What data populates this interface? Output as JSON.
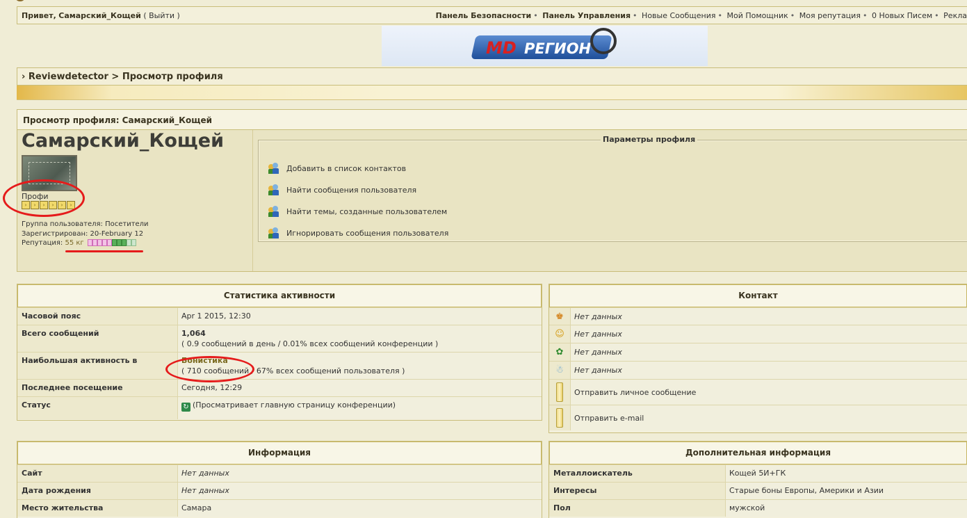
{
  "userbar": {
    "greeting": "Привет,",
    "username": "Самарский_Кощей",
    "logout": "( Выйти )",
    "links_bold": [
      "Панель Безопасности",
      "Панель Управления"
    ],
    "links": [
      "Новые Сообщения",
      "Мой Помощник",
      "Моя репутация",
      "0 Новых Писем",
      "Рекла"
    ]
  },
  "banner": {
    "md": "MD",
    "region": "РЕГИОН"
  },
  "nav": {
    "breadcrumb": "› Reviewdetector > Просмотр профиля"
  },
  "profile": {
    "header": "Просмотр профиля: Самарский_Кощей",
    "name": "Самарский_Кощей",
    "rank": "Профи",
    "pip_count": 6,
    "group": "Группа пользователя: Посетители",
    "registered": "Зарегистрирован: 20-February 12",
    "rep_label": "Репутация:",
    "rep_value": "55 кг",
    "params_title": "Параметры профиля",
    "params": [
      "Добавить в список контактов",
      "Найти сообщения пользователя",
      "Найти темы, созданные пользователем",
      "Игнорировать сообщения пользователя"
    ]
  },
  "stats": {
    "title": "Статистика активности",
    "timezone_label": "Часовой пояс",
    "timezone_value": "Apr 1 2015, 12:30",
    "posts_label": "Всего сообщений",
    "posts_value": "1,064",
    "posts_sub": "( 0.9 сообщений в день / 0.01% всех сообщений конференции )",
    "active_label": "Наибольшая активность в",
    "active_forum": "Бонистика",
    "active_sub": "( 710 сообщений / 67% всех сообщений пользователя )",
    "last_label": "Последнее посещение",
    "last_value": "Сегодня, 12:29",
    "status_label": "Статус",
    "status_value": "(Просматривает главную страницу конференции)"
  },
  "contact": {
    "title": "Контакт",
    "no_data": [
      "Нет данных",
      "Нет данных",
      "Нет данных",
      "Нет данных"
    ],
    "pm": "Отправить личное сообщение",
    "email": "Отправить e-mail"
  },
  "info": {
    "title": "Информация",
    "rows": [
      {
        "label": "Сайт",
        "value": "Нет данных"
      },
      {
        "label": "Дата рождения",
        "value": "Нет данных"
      },
      {
        "label": "Место жительства",
        "value": "Самара"
      }
    ]
  },
  "extra": {
    "title": "Дополнительная информация",
    "rows": [
      {
        "label": "Металлоискатель",
        "value": "Кощей 5И+ГК"
      },
      {
        "label": "Интересы",
        "value": "Старые боны Европы, Америки и Азии"
      },
      {
        "label": "Пол",
        "value": "мужской"
      }
    ]
  },
  "colors": {
    "accent_gold": "#e3b84a",
    "annotation_red": "#e51b1b",
    "background": "#f0edd6"
  }
}
